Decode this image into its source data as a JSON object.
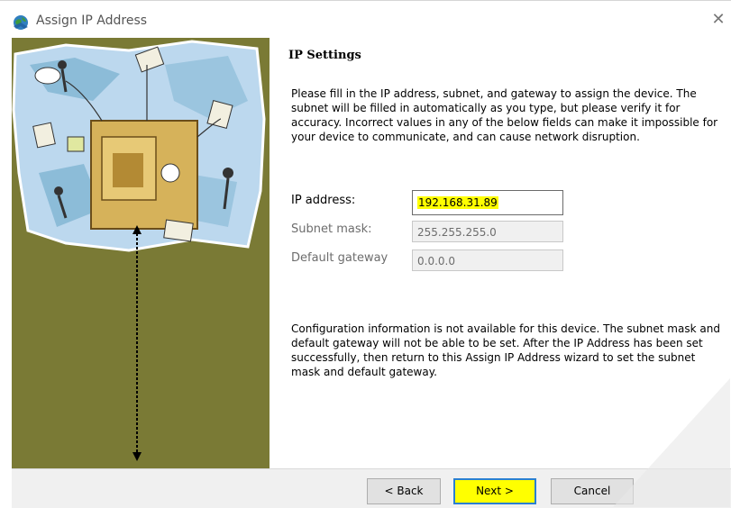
{
  "window": {
    "title": "Assign IP Address",
    "close_icon": "close-icon",
    "app_icon": "globe-network-icon"
  },
  "illustration": {
    "description_icon": "network-puzzle-illustration"
  },
  "page": {
    "section_title": "IP Settings",
    "intro": "Please fill in the IP address, subnet, and gateway to assign the device. The subnet will be filled in automatically as you type, but please verify it for accuracy.  Incorrect values in any of the below fields can make it impossible for your device to communicate, and can cause network disruption.",
    "fields": [
      {
        "label": "IP address:",
        "value": "192.168.31.89",
        "enabled": true,
        "highlighted": true
      },
      {
        "label": "Subnet mask:",
        "value": "255.255.255.0",
        "enabled": false
      },
      {
        "label": "Default gateway",
        "value": "0.0.0.0",
        "enabled": false
      }
    ],
    "info": "Configuration information is not available for this device.  The subnet mask and default gateway will not be able to be set.  After the IP Address has been set successfully, then return to this Assign IP Address wizard to set the subnet mask and default gateway."
  },
  "buttons": {
    "back": "< Back",
    "next": "Next >",
    "cancel": "Cancel"
  },
  "colors": {
    "side_panel": "#7a7a35",
    "highlight": "#ffff00",
    "focus_border": "#2a7fd0"
  }
}
